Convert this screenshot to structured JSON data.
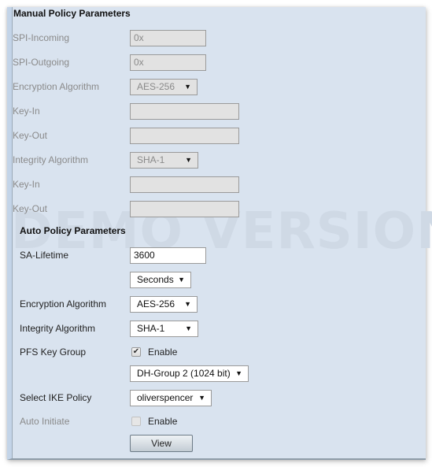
{
  "watermark": "DEMO VERSION",
  "manual": {
    "title": "Manual Policy Parameters",
    "spi_incoming": {
      "label": "SPI-Incoming",
      "value": "0x"
    },
    "spi_outgoing": {
      "label": "SPI-Outgoing",
      "value": "0x"
    },
    "encryption": {
      "label": "Encryption Algorithm",
      "value": "AES-256"
    },
    "enc_key_in": {
      "label": "Key-In",
      "value": ""
    },
    "enc_key_out": {
      "label": "Key-Out",
      "value": ""
    },
    "integrity": {
      "label": "Integrity Algorithm",
      "value": "SHA-1"
    },
    "int_key_in": {
      "label": "Key-In",
      "value": ""
    },
    "int_key_out": {
      "label": "Key-Out",
      "value": ""
    }
  },
  "auto": {
    "title": "Auto Policy Parameters",
    "sa_lifetime": {
      "label": "SA-Lifetime",
      "value": "3600",
      "unit": "Seconds"
    },
    "encryption": {
      "label": "Encryption Algorithm",
      "value": "AES-256"
    },
    "integrity": {
      "label": "Integrity Algorithm",
      "value": "SHA-1"
    },
    "pfs": {
      "label": "PFS Key Group",
      "checkbox_label": "Enable",
      "checked": true,
      "group": "DH-Group 2 (1024 bit)"
    },
    "ike_policy": {
      "label": "Select IKE Policy",
      "value": "oliverspencer"
    },
    "auto_initiate": {
      "label": "Auto Initiate",
      "checkbox_label": "Enable",
      "checked": false
    },
    "view_button": "View"
  },
  "icons": {
    "dropdown_arrow": "▼",
    "checkmark": "✔"
  }
}
